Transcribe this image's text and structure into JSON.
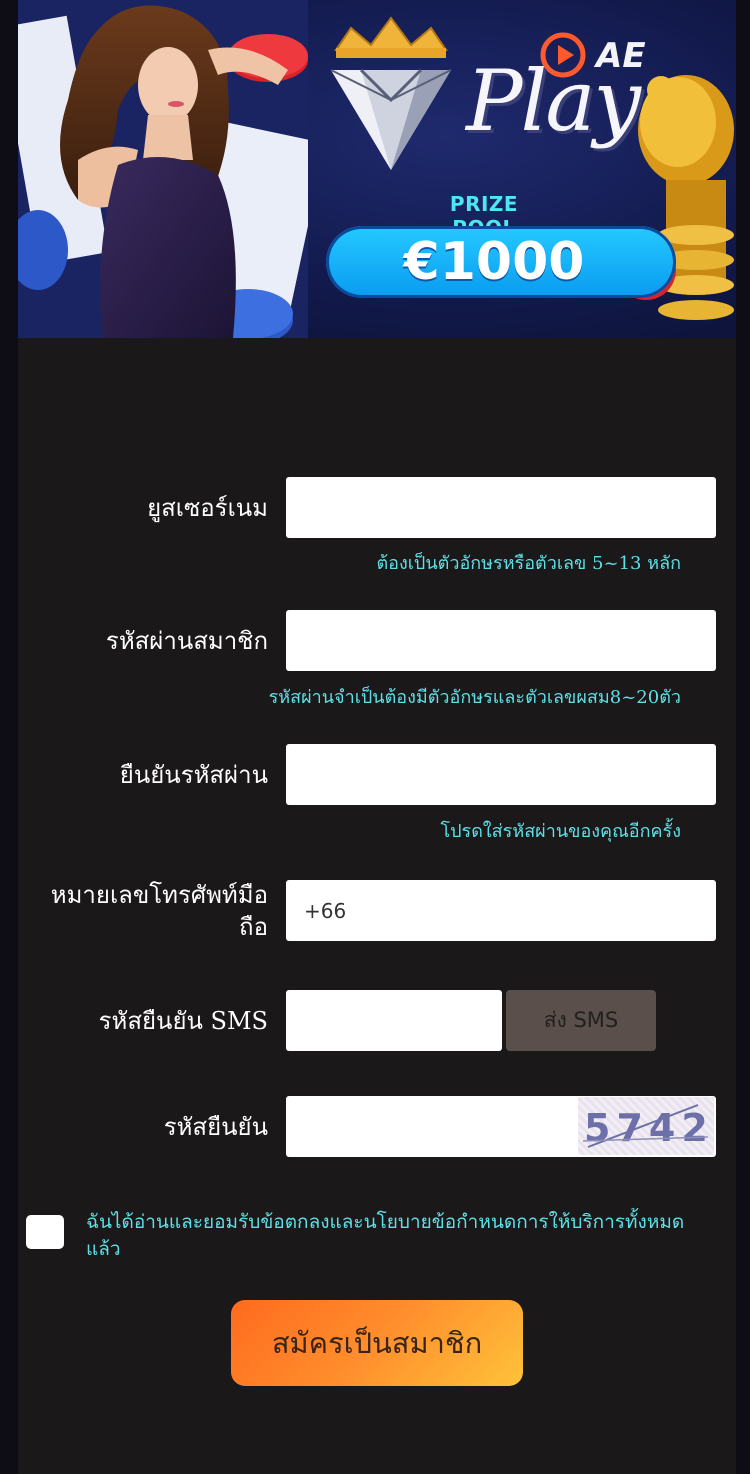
{
  "banner": {
    "brand_ae": "AE",
    "brand_play": "Play",
    "prize_label": "PRIZE POOL",
    "prize_amount": "€1000"
  },
  "form": {
    "username": {
      "label": "ยูสเซอร์เนม",
      "value": "",
      "hint": "ต้องเป็นตัวอักษรหรือตัวเลข 5~13 หลัก"
    },
    "password": {
      "label": "รหัสผ่านสมาชิก",
      "value": "",
      "hint": "รหัสผ่านจำเป็นต้องมีตัวอักษรและตัวเลขผสม8~20ตัว"
    },
    "confirm_password": {
      "label": "ยืนยันรหัสผ่าน",
      "value": "",
      "hint": "โปรดใส่รหัสผ่านของคุณอีกครั้ง"
    },
    "phone": {
      "label_line1": "หมายเลขโทรศัพท์มือ",
      "label_line2": "ถือ",
      "value": "+66"
    },
    "sms_code": {
      "label": "รหัสยืนยัน SMS",
      "value": "",
      "button_label": "ส่ง SMS"
    },
    "captcha": {
      "label": "รหัสยืนยัน",
      "value": "",
      "image_text": "5742"
    },
    "agree_text": "ฉันได้อ่านและยอมรับข้อตกลงและนโยบายข้อกำหนดการให้บริการทั้งหมดแล้ว",
    "agree_checked": false,
    "submit_label": "สมัครเป็นสมาชิก"
  },
  "colors": {
    "background": "#1a1819",
    "hint": "#5fe0e8",
    "submit_start": "#ff6a1e",
    "submit_end": "#ffc23a",
    "sms_button": "#5a4f4a",
    "prize_pill": "#1bb6fb"
  }
}
